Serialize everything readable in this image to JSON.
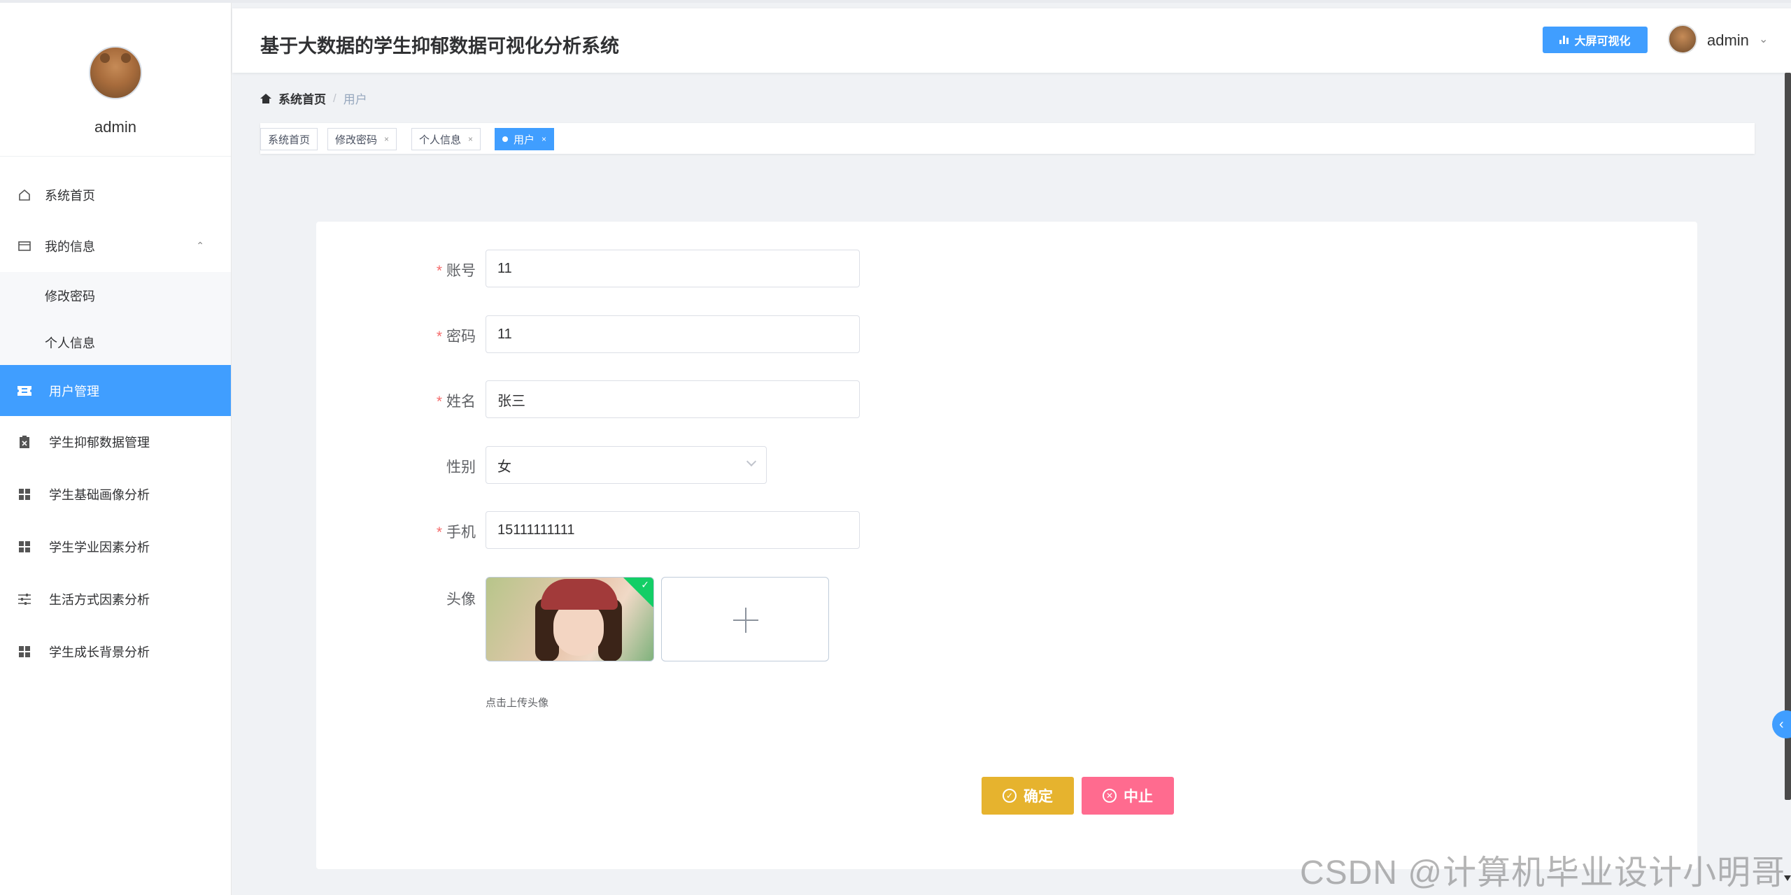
{
  "sidebar": {
    "username": "admin",
    "items": [
      {
        "label": "系统首页",
        "icon": "home-icon"
      },
      {
        "label": "我的信息",
        "icon": "profile-card-icon",
        "expanded": true,
        "children": [
          {
            "label": "修改密码"
          },
          {
            "label": "个人信息"
          }
        ]
      },
      {
        "label": "用户管理",
        "icon": "ticket-icon",
        "active": true
      },
      {
        "label": "学生抑郁数据管理",
        "icon": "clipboard-icon"
      },
      {
        "label": "学生基础画像分析",
        "icon": "grid-icon"
      },
      {
        "label": "学生学业因素分析",
        "icon": "grid-icon"
      },
      {
        "label": "生活方式因素分析",
        "icon": "sliders-icon"
      },
      {
        "label": "学生成长背景分析",
        "icon": "grid-icon"
      }
    ]
  },
  "header": {
    "title": "基于大数据的学生抑郁数据可视化分析系统",
    "screen_button": "大屏可视化",
    "user": "admin"
  },
  "breadcrumb": {
    "home": "系统首页",
    "separator": "/",
    "current": "用户"
  },
  "tags": [
    {
      "label": "系统首页",
      "closable": false,
      "active": false
    },
    {
      "label": "修改密码",
      "closable": true,
      "active": false
    },
    {
      "label": "个人信息",
      "closable": true,
      "active": false
    },
    {
      "label": "用户",
      "closable": true,
      "active": true
    }
  ],
  "form": {
    "account": {
      "label": "账号",
      "required": true,
      "value": "11"
    },
    "password": {
      "label": "密码",
      "required": true,
      "value": "11"
    },
    "name": {
      "label": "姓名",
      "required": true,
      "value": "张三"
    },
    "gender": {
      "label": "性别",
      "required": false,
      "value": "女"
    },
    "phone": {
      "label": "手机",
      "required": true,
      "value": "15111111111"
    },
    "avatar": {
      "label": "头像",
      "tip": "点击上传头像"
    },
    "submit_label": "确定",
    "cancel_label": "中止"
  },
  "watermark": "CSDN @计算机毕业设计小明哥",
  "colors": {
    "primary": "#409eff",
    "submit": "#e6b32e",
    "cancel": "#ff6b8f",
    "required": "#f56c6c"
  }
}
